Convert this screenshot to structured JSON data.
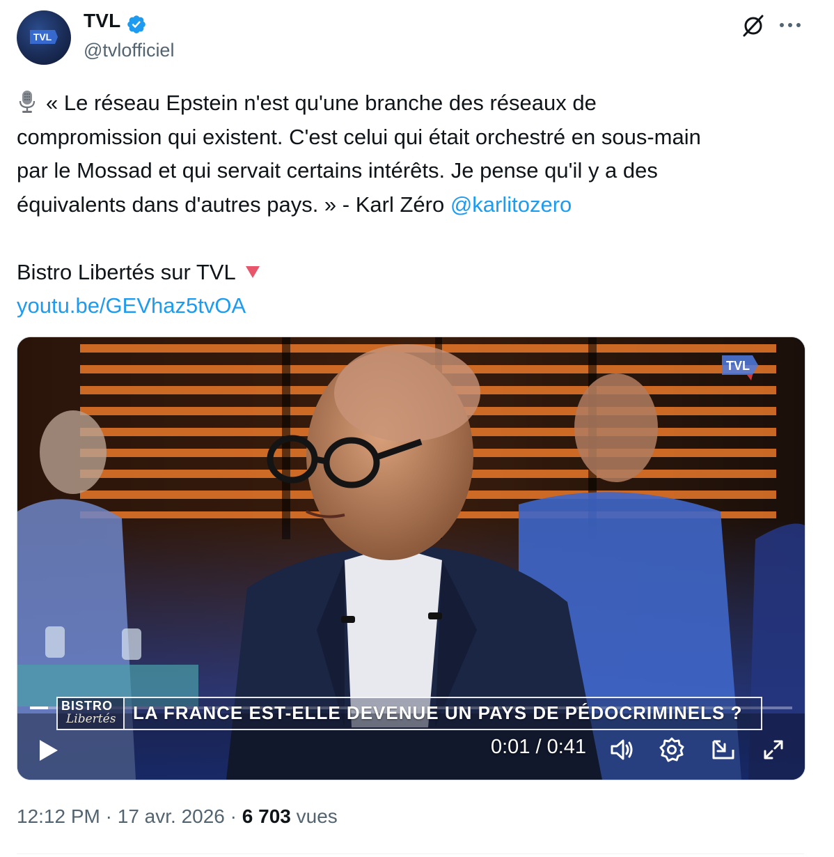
{
  "author": {
    "name": "TVL",
    "handle": "@tvlofficiel",
    "avatar_logo_text": "TVL",
    "verified": true,
    "verified_color": "#1d9bf0"
  },
  "header_icons": [
    "grok-icon",
    "more-icon"
  ],
  "tweet": {
    "emoji": "studio-microphone",
    "line1": "« Le réseau Epstein n'est qu'une branche des réseaux de",
    "line2": "compromission qui existent. C'est celui qui était orchestré en sous-main",
    "line3": "par le Mossad et qui servait certains intérêts. Je pense qu'il y a des",
    "line4_text": "équivalents dans d'autres pays. » - Karl Zéro",
    "mention": "@karlitozero",
    "line5_text": "Bistro Libertés sur TVL",
    "line5_emoji": "red-triangle-down",
    "link": "youtu.be/GEVhaz5tvOA",
    "link_color": "#1d9bf0"
  },
  "video": {
    "watermark": "TVL",
    "show_title": "BISTRO",
    "show_subtitle": "Libertés",
    "headline": "LA FRANCE EST-ELLE DEVENUE UN PAYS DE PÉDOCRIMINELS ?",
    "current_time": "0:01",
    "duration": "0:41",
    "timecode": "0:01 / 0:41",
    "progress_fraction": 0.024,
    "controls": [
      "play-icon",
      "volume-icon",
      "settings-icon",
      "pip-icon",
      "fullscreen-icon"
    ]
  },
  "meta": {
    "time": "12:12 PM",
    "sep1": "·",
    "date": "17 avr. 2026",
    "sep2": "·",
    "views_count": "6 703",
    "views_label": "vues"
  }
}
